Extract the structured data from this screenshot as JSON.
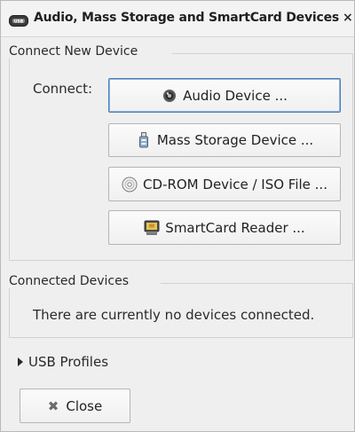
{
  "window": {
    "title": "Audio, Mass Storage and SmartCard Devices",
    "title_icon": "usb-icon",
    "close_glyph": "×"
  },
  "connect_group": {
    "title": "Connect New Device",
    "label": "Connect:",
    "buttons": [
      {
        "label": "Audio Device ...",
        "icon": "speaker-icon"
      },
      {
        "label": "Mass Storage Device ...",
        "icon": "usb-drive-icon"
      },
      {
        "label": "CD-ROM Device / ISO File ...",
        "icon": "cd-icon"
      },
      {
        "label": "SmartCard Reader ...",
        "icon": "smartcard-reader-icon"
      }
    ]
  },
  "connected_group": {
    "title": "Connected Devices",
    "empty_message": "There are currently no devices connected."
  },
  "usb_profiles": {
    "label": "USB Profiles",
    "expanded": false
  },
  "footer": {
    "close_label": "Close",
    "close_icon": "close-x-icon"
  },
  "colors": {
    "window_bg": "#efefef",
    "focus_border": "#4a7fb6"
  }
}
